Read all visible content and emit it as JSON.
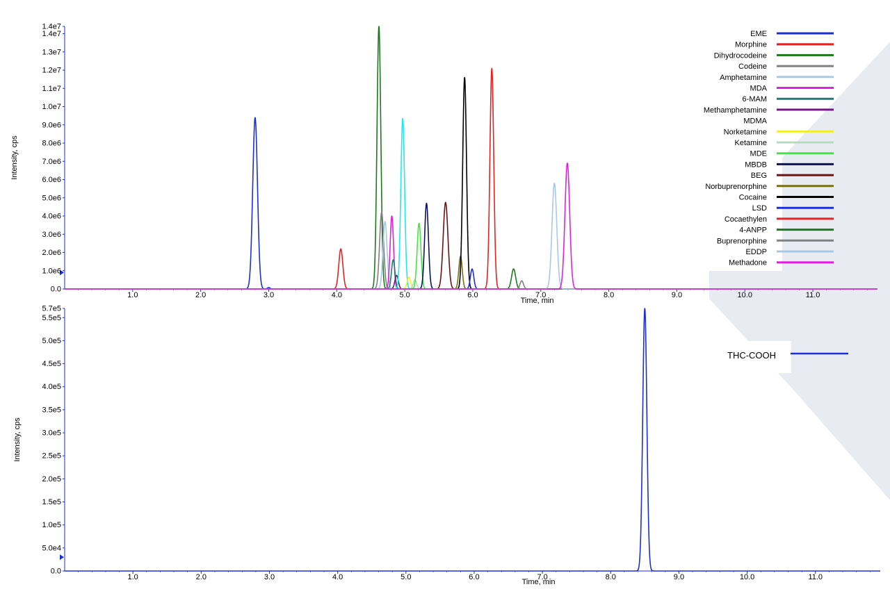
{
  "chart_data": [
    {
      "type": "line",
      "xlabel": "Time, min",
      "ylabel": "Intensity, cps",
      "xlim": [
        0.0,
        11.95
      ],
      "ylim": [
        0,
        14400000
      ],
      "x_ticks": [
        1.0,
        2.0,
        3.0,
        4.0,
        5.0,
        6.0,
        7.0,
        8.0,
        9.0,
        10.0,
        11.0
      ],
      "x_tick_labels": [
        "1.0",
        "2.0",
        "3.0",
        "4.0",
        "5.0",
        "6.0",
        "7.0",
        "8.0",
        "9.0",
        "10.0",
        "11.0"
      ],
      "y_ticks": [
        0,
        1000000,
        2000000,
        3000000,
        4000000,
        5000000,
        6000000,
        7000000,
        8000000,
        9000000,
        10000000,
        11000000,
        12000000,
        13000000,
        14000000,
        14400000
      ],
      "y_tick_labels": [
        "0.0",
        "1.0e6",
        "2.0e6",
        "3.0e6",
        "4.0e6",
        "5.0e6",
        "6.0e6",
        "7.0e6",
        "8.0e6",
        "9.0e6",
        "1.0e7",
        "1.1e7",
        "1.2e7",
        "1.3e7",
        "1.4e7",
        "1.4e7"
      ],
      "legend_position": "top-right",
      "series": [
        {
          "name": "EME",
          "color": "#1a2fd6",
          "peaks": [
            {
              "rt": 2.8,
              "height": 9400000,
              "width": 0.035
            },
            {
              "rt": 3.0,
              "height": 80000,
              "width": 0.02
            }
          ]
        },
        {
          "name": "Morphine",
          "color": "#e82020",
          "peaks": [
            {
              "rt": 4.06,
              "height": 2200000,
              "width": 0.03
            }
          ]
        },
        {
          "name": "Dihydrocodeine",
          "color": "#1a7a1a",
          "peaks": [
            {
              "rt": 4.62,
              "height": 14400000,
              "width": 0.028
            }
          ]
        },
        {
          "name": "Codeine",
          "color": "#808080",
          "peaks": [
            {
              "rt": 4.66,
              "height": 4200000,
              "width": 0.03
            }
          ]
        },
        {
          "name": "Amphetamine",
          "color": "#a8c8e8",
          "peaks": [
            {
              "rt": 4.71,
              "height": 3700000,
              "width": 0.03
            }
          ]
        },
        {
          "name": "MDA",
          "color": "#e020e0",
          "peaks": [
            {
              "rt": 4.81,
              "height": 4000000,
              "width": 0.025
            }
          ]
        },
        {
          "name": "6-MAM",
          "color": "#207878",
          "peaks": [
            {
              "rt": 4.83,
              "height": 1600000,
              "width": 0.025
            }
          ]
        },
        {
          "name": "Methamphetamine",
          "color": "#701880",
          "peaks": [
            {
              "rt": 4.88,
              "height": 750000,
              "width": 0.025
            }
          ]
        },
        {
          "name": "MDMA",
          "color": "#20e8f0",
          "peaks": [
            {
              "rt": 4.97,
              "height": 9350000,
              "width": 0.028
            }
          ]
        },
        {
          "name": "Norketamine",
          "color": "#f0f020",
          "peaks": [
            {
              "rt": 5.06,
              "height": 650000,
              "width": 0.025
            }
          ]
        },
        {
          "name": "Ketamine",
          "color": "#b8d8c0",
          "peaks": [
            {
              "rt": 5.15,
              "height": 500000,
              "width": 0.025
            }
          ]
        },
        {
          "name": "MDE",
          "color": "#40e840",
          "peaks": [
            {
              "rt": 5.21,
              "height": 3600000,
              "width": 0.028
            }
          ]
        },
        {
          "name": "MBDB",
          "color": "#101060",
          "peaks": [
            {
              "rt": 5.32,
              "height": 4700000,
              "width": 0.028
            }
          ]
        },
        {
          "name": "BEG",
          "color": "#701010",
          "peaks": [
            {
              "rt": 5.6,
              "height": 4750000,
              "width": 0.035
            }
          ]
        },
        {
          "name": "Norbuprenorphine",
          "color": "#787010",
          "peaks": [
            {
              "rt": 5.82,
              "height": 1800000,
              "width": 0.025
            }
          ]
        },
        {
          "name": "Cocaine",
          "color": "#000000",
          "peaks": [
            {
              "rt": 5.88,
              "height": 11600000,
              "width": 0.028
            }
          ]
        },
        {
          "name": "LSD",
          "color": "#1a2fd6",
          "peaks": [
            {
              "rt": 5.99,
              "height": 1100000,
              "width": 0.025
            }
          ]
        },
        {
          "name": "Cocaethylen",
          "color": "#e82020",
          "peaks": [
            {
              "rt": 6.28,
              "height": 12100000,
              "width": 0.028
            }
          ]
        },
        {
          "name": "4-ANPP",
          "color": "#1a7a1a",
          "peaks": [
            {
              "rt": 6.6,
              "height": 1100000,
              "width": 0.03
            }
          ]
        },
        {
          "name": "Buprenorphine",
          "color": "#808080",
          "peaks": [
            {
              "rt": 6.72,
              "height": 450000,
              "width": 0.025
            }
          ]
        },
        {
          "name": "EDDP",
          "color": "#a8c8e8",
          "peaks": [
            {
              "rt": 7.2,
              "height": 5800000,
              "width": 0.035
            }
          ]
        },
        {
          "name": "Methadone",
          "color": "#e020e0",
          "peaks": [
            {
              "rt": 7.39,
              "height": 6900000,
              "width": 0.035
            }
          ]
        }
      ]
    },
    {
      "type": "line",
      "xlabel": "Time, min",
      "ylabel": "Intensity, cps",
      "xlim": [
        0.0,
        11.95
      ],
      "ylim": [
        0,
        570000
      ],
      "x_ticks": [
        1.0,
        2.0,
        3.0,
        4.0,
        5.0,
        6.0,
        7.0,
        8.0,
        9.0,
        10.0,
        11.0
      ],
      "x_tick_labels": [
        "1.0",
        "2.0",
        "3.0",
        "4.0",
        "5.0",
        "6.0",
        "7.0",
        "8.0",
        "9.0",
        "10.0",
        "11.0"
      ],
      "y_ticks": [
        0,
        50000,
        100000,
        150000,
        200000,
        250000,
        300000,
        350000,
        400000,
        450000,
        500000,
        550000,
        570000
      ],
      "y_tick_labels": [
        "0.0",
        "5.0e4",
        "1.0e5",
        "1.5e5",
        "2.0e5",
        "2.5e5",
        "3.0e5",
        "3.5e5",
        "4.0e5",
        "4.5e5",
        "5.0e5",
        "5.5e5",
        "5.7e5"
      ],
      "legend_position": "top-right",
      "series": [
        {
          "name": "THC-COOH",
          "color": "#1a2fd6",
          "peaks": [
            {
              "rt": 8.5,
              "height": 570000,
              "width": 0.03
            }
          ]
        }
      ]
    }
  ],
  "watermark_color": "#e8ecf2"
}
